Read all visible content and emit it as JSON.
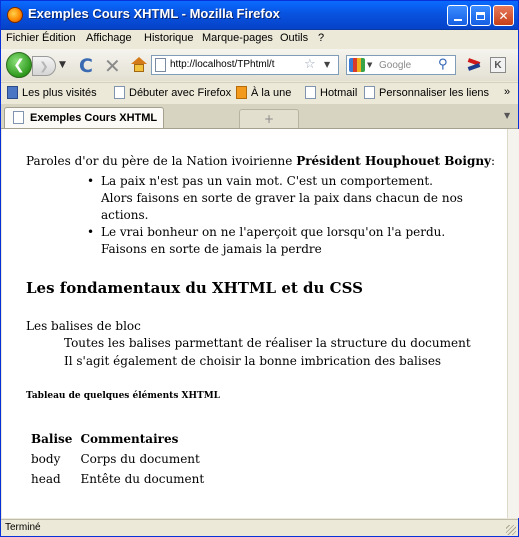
{
  "window": {
    "title": "Exemples Cours XHTML - Mozilla Firefox"
  },
  "menu": [
    "Fichier",
    "Édition",
    "Affichage",
    "Historique",
    "Marque-pages",
    "Outils",
    "?"
  ],
  "navbar": {
    "url": "http://localhost/TPhtml/t",
    "search_placeholder": "Google"
  },
  "bookmarks": [
    "Les plus visités",
    "Débuter avec Firefox",
    "À la une",
    "Hotmail",
    "Personnaliser les liens"
  ],
  "bookmarks_more": "»",
  "tab": {
    "label": "Exemples Cours XHTML",
    "new_tab": "+"
  },
  "content": {
    "intro_prefix": "Paroles d'or du père de la Nation ivoirienne ",
    "intro_bold": "Président Houphouet Boigny",
    "intro_suffix": ":",
    "quotes": [
      "La paix n'est pas un vain mot. C'est un comportement. Alors faisons en sorte de graver la paix dans chacun de nos actions.",
      "Le vrai bonheur on ne l'aperçoit que lorsqu'on l'a perdu. Faisons en sorte de jamais la perdre"
    ],
    "heading": "Les fondamentaux du XHTML et du CSS",
    "dl_term": "Les balises de bloc",
    "dl_defs": [
      "Toutes les balises parmettant de réaliser la structure du document",
      "Il s'agit également de choisir la bonne imbrication des balises"
    ],
    "table_caption": "Tableau de quelques éléments XHTML",
    "table": {
      "headers": [
        "Balise",
        "Commentaires"
      ],
      "rows": [
        [
          "body",
          "Corps du document"
        ],
        [
          "head",
          "Entête du document"
        ]
      ]
    }
  },
  "status": {
    "text": "Terminé"
  }
}
